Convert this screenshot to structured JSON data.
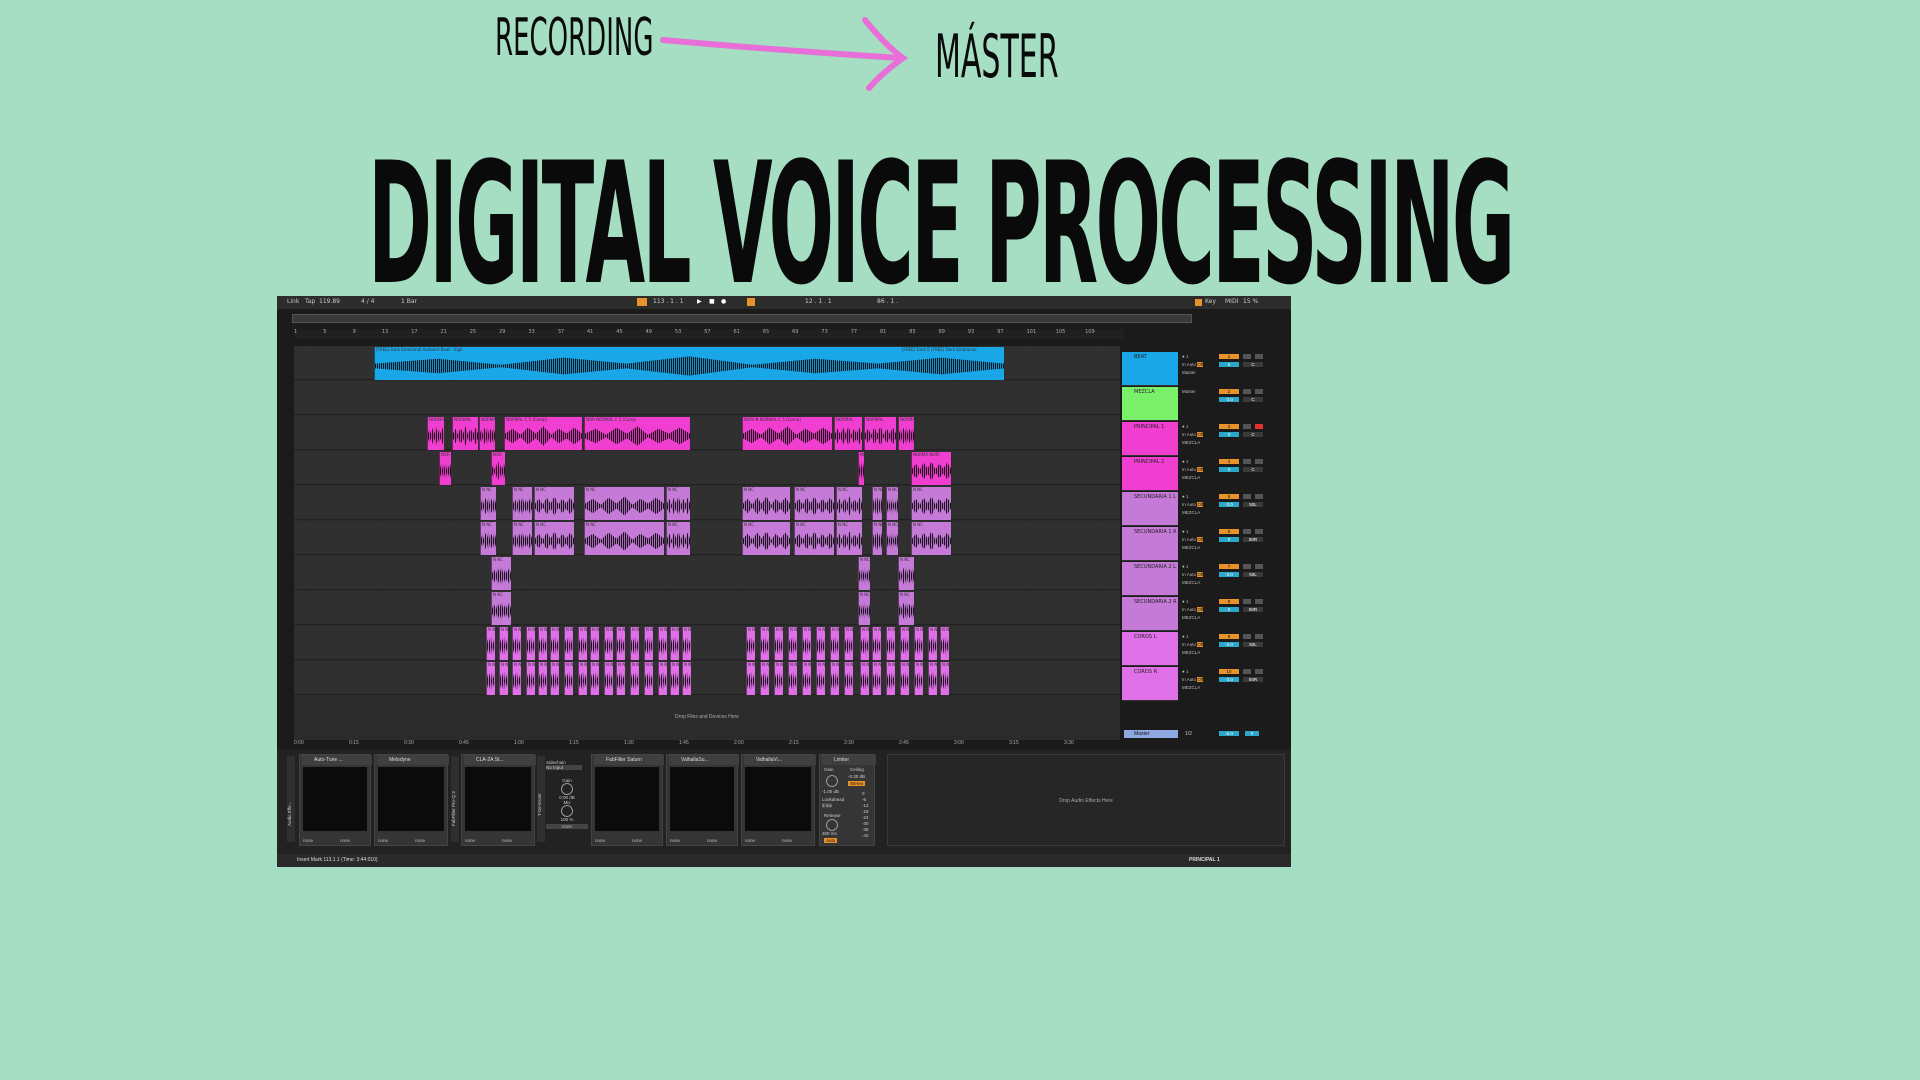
{
  "header": {
    "recording": "RECORDING",
    "master": "MÁSTER",
    "title": "DIGITAL VOICE PROCESSING"
  },
  "colors": {
    "background": "#a5dec3",
    "accent_arrow": "#e86fd8",
    "beat": "#1aa7e8",
    "mezcla": "#7aef6a",
    "principal": "#f03fd0",
    "secundaria": "#c67ad8",
    "coros": "#e070e8",
    "orange": "#e8922a"
  },
  "toolbar": {
    "link": "Link",
    "tap": "Tap",
    "tempo": "119.89",
    "sig": "4 / 4",
    "quant": "1 Bar",
    "pos1": "113 . 1 . 1",
    "pos2": "12 . 1 . 1",
    "pos3": "86 . 1 .",
    "key": "Key",
    "midi": "MIDI",
    "cpu": "15 %"
  },
  "ruler": [
    "1",
    "5",
    "9",
    "13",
    "17",
    "21",
    "25",
    "29",
    "33",
    "37",
    "41",
    "45",
    "49",
    "53",
    "57",
    "61",
    "65",
    "69",
    "73",
    "77",
    "81",
    "85",
    "89",
    "93",
    "97",
    "101",
    "105",
    "109"
  ],
  "timeline": [
    "0:00",
    "0:15",
    "0:30",
    "0:45",
    "1:00",
    "1:15",
    "1:30",
    "1:45",
    "2:00",
    "2:15",
    "2:30",
    "2:45",
    "3:00",
    "3:15",
    "3:30"
  ],
  "clips": {
    "beat": "[FREE] Dark Emotional Ambient Beat - Sigh",
    "beat_end": "[FREE] Dark E [FREE] Dark Emotional",
    "principal1_a": "NORMAL",
    "principal1_b": "NORMAL C 5 (Comp)",
    "principal1_c": "NOR NORMAL C 5 (Comp",
    "principal1_d": "NORI N NORMAL C 5 (Comp)",
    "principal2": "NOR",
    "principal2_end": "NORMA NORI",
    "secundaria": "N NC"
  },
  "tracks": [
    {
      "name": "BEAT",
      "color": "#1aa7e8",
      "num": "1",
      "route": "Master",
      "vol": "0",
      "pan": "C"
    },
    {
      "name": "MEZCLA",
      "color": "#7aef6a",
      "num": "2",
      "route": "Master",
      "vol": "-3.0",
      "pan": "C"
    },
    {
      "name": "PRINCIPAL 1",
      "color": "#f03fd0",
      "num": "3",
      "route": "MEZCLA",
      "vol": "0",
      "pan": "C"
    },
    {
      "name": "PRINCIPAL 2",
      "color": "#f03fd0",
      "num": "4",
      "route": "MEZCLA",
      "vol": "0",
      "pan": "C"
    },
    {
      "name": "SECUNDARIA 1 L",
      "color": "#c67ad8",
      "num": "5",
      "route": "MEZCLA",
      "vol": "-3.0",
      "pan": "50L"
    },
    {
      "name": "SECUNDARIA 1 R",
      "color": "#c67ad8",
      "num": "6",
      "route": "MEZCLA",
      "vol": "0",
      "pan": "50R"
    },
    {
      "name": "SECUNDARIA 2 L",
      "color": "#c67ad8",
      "num": "7",
      "route": "MEZCLA",
      "vol": "-3.0",
      "pan": "50L"
    },
    {
      "name": "SECUNDARIA 2 R",
      "color": "#c67ad8",
      "num": "8",
      "route": "MEZCLA",
      "vol": "0",
      "pan": "50R"
    },
    {
      "name": "COROS L",
      "color": "#e070e8",
      "num": "9",
      "route": "MEZCLA",
      "vol": "-3.0",
      "pan": "50L"
    },
    {
      "name": "COROS R",
      "color": "#e070e8",
      "num": "10",
      "route": "MEZCLA",
      "vol": "-3.0",
      "pan": "50R"
    }
  ],
  "io": {
    "in": "In",
    "auto": "Auto",
    "off": "Off"
  },
  "master": {
    "name": "Master",
    "route": "1/2",
    "vol": "-6.0",
    "pan": "0"
  },
  "drop_files": "Drop Files and Devices Here",
  "devices": [
    {
      "name": "Auto-Tune ...",
      "a": "none",
      "b": "none"
    },
    {
      "name": "Melodyne",
      "a": "none",
      "b": "none"
    },
    {
      "name": "CLA-2A St...",
      "a": "none",
      "b": "none"
    },
    {
      "name": "FabFilter Saturn",
      "a": "none",
      "b": "none"
    },
    {
      "name": "ValhallaSu...",
      "a": "none",
      "b": "none"
    },
    {
      "name": "ValhallaVi...",
      "a": "none",
      "b": "none"
    }
  ],
  "side_labels": {
    "audio_effects": "Audio Effe...",
    "fabfilter": "FabFilter Pro-Q 3",
    "deesser": "T-De-Esser"
  },
  "deesser": {
    "sidechain": "Sidechain",
    "input": "No Input",
    "gain_label": "Gain",
    "gain": "0.00 dB",
    "mix_label": "Mix",
    "mix": "100 %",
    "mute": "Mute"
  },
  "limiter": {
    "name": "Limiter",
    "gain_label": "Gain",
    "gain": "-1.00 dB",
    "ceiling_label": "Ceiling",
    "ceiling": "-0.30 dB",
    "stereo": "Stereo",
    "lookahead_label": "Lookahead",
    "lookahead": "3 ms",
    "release_label": "Release",
    "release": "300 ms",
    "auto": "Auto",
    "scale": [
      "0",
      "-6",
      "-12",
      "-18",
      "-24",
      "-30",
      "-36",
      "-42"
    ]
  },
  "drop_effects": "Drop Audio Effects Here",
  "status": {
    "left": "Insert Mark 113.1.1 (Time: 3:44:010)",
    "right": "PRINCIPAL 1"
  }
}
